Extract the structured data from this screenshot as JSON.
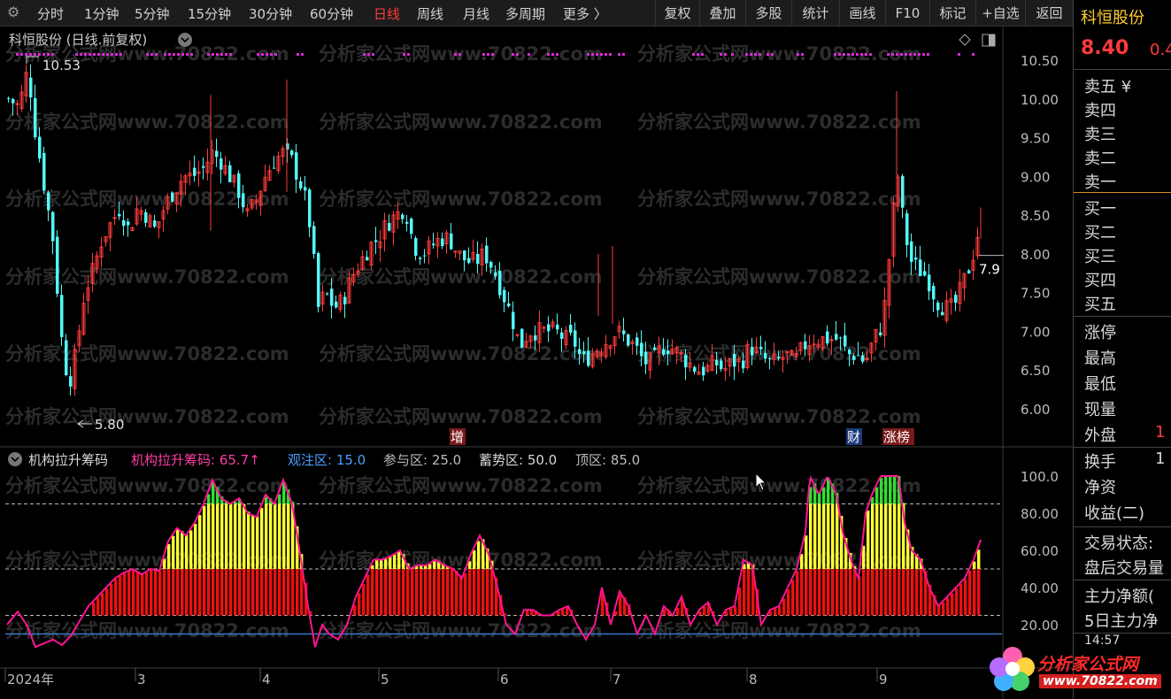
{
  "toolbar": {
    "periods": [
      "分时",
      "1分钟",
      "5分钟",
      "15分钟",
      "30分钟",
      "60分钟",
      "日线",
      "周线",
      "月线",
      "多周期",
      "更多 〉"
    ],
    "active_period": "日线",
    "buttons": [
      "复权",
      "叠加",
      "多股",
      "统计",
      "画线",
      "F10",
      "标记",
      "+自选",
      "返回"
    ]
  },
  "chart_header": {
    "title": "科恒股份 (日线.前复权)",
    "high_label": "10.53",
    "low_label": "5.80",
    "last_price_tag": "7.9"
  },
  "main_axis": {
    "ticks": [
      "10.50",
      "10.00",
      "9.50",
      "9.00",
      "8.50",
      "8.00",
      "7.50",
      "7.00",
      "6.50",
      "6.00"
    ]
  },
  "event_tags": [
    "增",
    "财",
    "涨榜"
  ],
  "indicator": {
    "name": "机构拉升筹码",
    "value_label": "机构拉升筹码: 65.7",
    "watch_label": "观注区: 15.0",
    "join_label": "参与区: 25.0",
    "accumulate_label": "蓄势区: 50.0",
    "top_label": "顶区: 85.0",
    "ticks": [
      "100.0",
      "80.00",
      "60.00",
      "40.00",
      "20.00"
    ]
  },
  "date_axis": [
    "2024年",
    "3",
    "4",
    "5",
    "6",
    "7",
    "8",
    "9"
  ],
  "watermark": "分析家公式网www.70822.com",
  "side_panel": {
    "title": "科恒股份",
    "price": "8.40",
    "change": "0.4",
    "ask": [
      "卖五 ¥",
      "卖四",
      "卖三",
      "卖二",
      "卖一"
    ],
    "bid": [
      "买一",
      "买二",
      "买三",
      "买四",
      "买五"
    ],
    "stats": [
      "涨停",
      "最高",
      "最低",
      "现量",
      "外盘"
    ],
    "outer_value": "1",
    "stats2": [
      "换手",
      "净资",
      "收益(二)"
    ],
    "turnover_value": "1",
    "trade_state_label": "交易状态:",
    "trade_state_value": "盘后交易量",
    "flow1": "主力净额(",
    "flow2": "5日主力净",
    "time": "14:57"
  },
  "logo": {
    "name": "分析家公式网",
    "url": "www.70822.com"
  },
  "colors": {
    "up": "#ff3b3b",
    "down": "#54f7f7",
    "yellow": "#ffff33",
    "green": "#33dd33",
    "red_bar": "#ee1010",
    "magenta": "#ff1493",
    "watch_line": "#3a78c8",
    "dot": "#d62ad6"
  },
  "chart_data": {
    "type": "candlestick",
    "title": "科恒股份 (日线.前复权)",
    "y_range": [
      5.8,
      10.53
    ],
    "high": 10.53,
    "low": 5.8,
    "indicator_series": {
      "name": "机构拉升筹码",
      "last": 65.7,
      "levels": {
        "观注区": 15.0,
        "参与区": 25.0,
        "蓄势区": 50.0,
        "顶区": 85.0
      },
      "y_range": [
        0,
        100
      ]
    }
  }
}
